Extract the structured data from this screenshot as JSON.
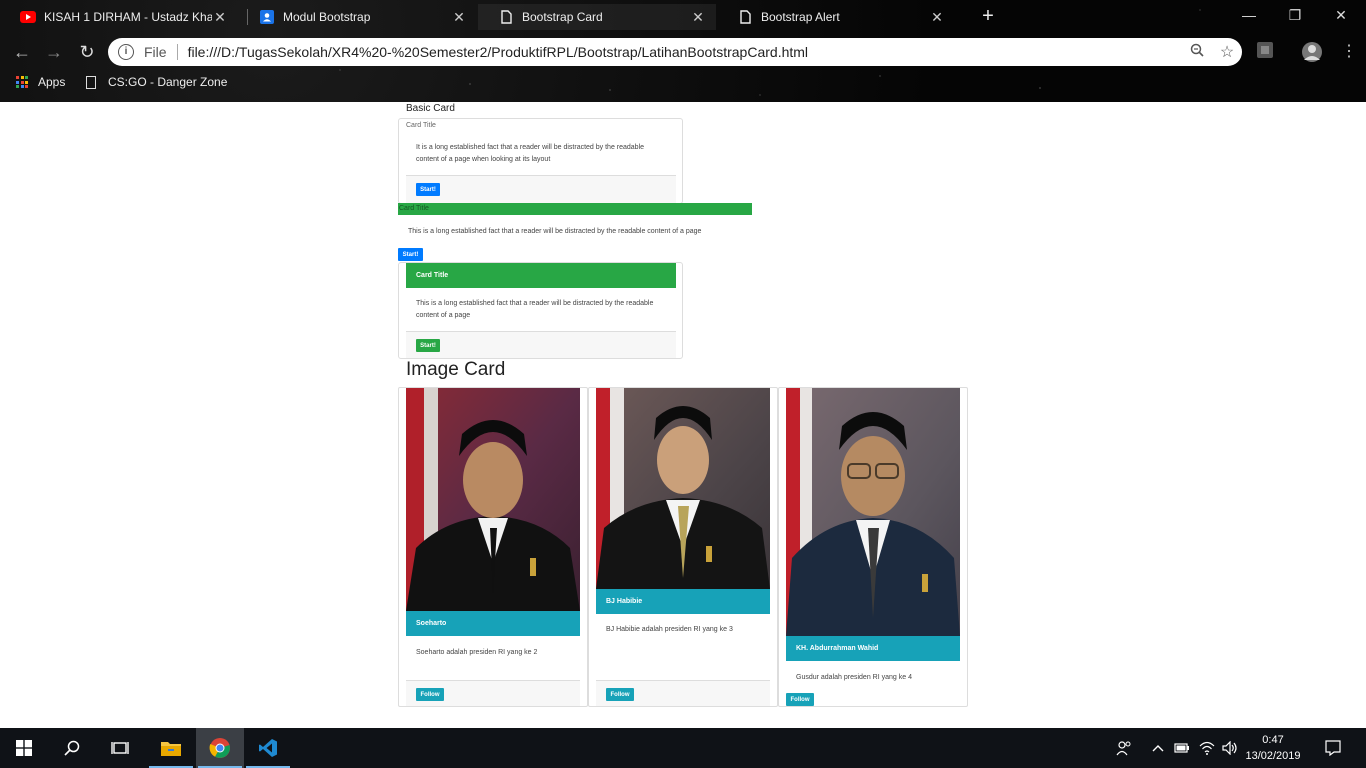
{
  "browser": {
    "tabs": [
      {
        "title": "KISAH 1 DIRHAM - Ustadz Khalid",
        "favicon": "youtube-icon",
        "active": false
      },
      {
        "title": "Modul Bootstrap",
        "favicon": "contact-card-icon",
        "active": false
      },
      {
        "title": "Bootstrap Card",
        "favicon": "page-icon",
        "active": true
      },
      {
        "title": "Bootstrap Alert",
        "favicon": "page-icon",
        "active": false
      }
    ],
    "new_tab": "+",
    "omnibox": {
      "scheme_label": "File",
      "url": "file:///D:/TugasSekolah/XR4%20-%20Semester2/ProduktifRPL/Bootstrap/LatihanBootstrapCard.html"
    },
    "bookmarks": [
      {
        "label": "Apps",
        "icon": "apps-grid-icon"
      },
      {
        "label": "CS:GO - Danger Zone",
        "icon": "page-icon"
      }
    ]
  },
  "page": {
    "basic_heading": "Basic Card",
    "card1": {
      "title": "Card Title",
      "text": "It is a long established fact that a reader will be distracted by the readable content of a page when looking at its layout",
      "button": "Start!"
    },
    "card2": {
      "title": "Card Title",
      "text": "This is a long established fact that a reader will be distracted by the readable content of a page",
      "button": "Start!"
    },
    "card3": {
      "header": "Card Title",
      "text": "This is a long established fact that a reader will be distracted by the readable content of a page",
      "button": "Start!"
    },
    "image_heading": "Image Card",
    "image_cards": [
      {
        "name": "Soeharto",
        "text": "Soeharto adalah presiden RI yang ke 2",
        "button": "Follow"
      },
      {
        "name": "BJ Habibie",
        "text": "BJ Habibie adalah presiden RI yang ke 3",
        "button": "Follow"
      },
      {
        "name": "KH. Abdurrahman Wahid",
        "text": "Gusdur adalah presiden RI yang ke 4",
        "button": "Follow"
      }
    ],
    "colors": {
      "primary": "#007bff",
      "success": "#28a745",
      "info": "#17a2b8"
    }
  },
  "taskbar": {
    "apps": [
      "windows-start-icon",
      "search-icon",
      "task-view-icon",
      "file-explorer-icon",
      "chrome-icon",
      "vscode-icon"
    ],
    "clock": {
      "time": "0:47",
      "date": "13/02/2019"
    }
  }
}
